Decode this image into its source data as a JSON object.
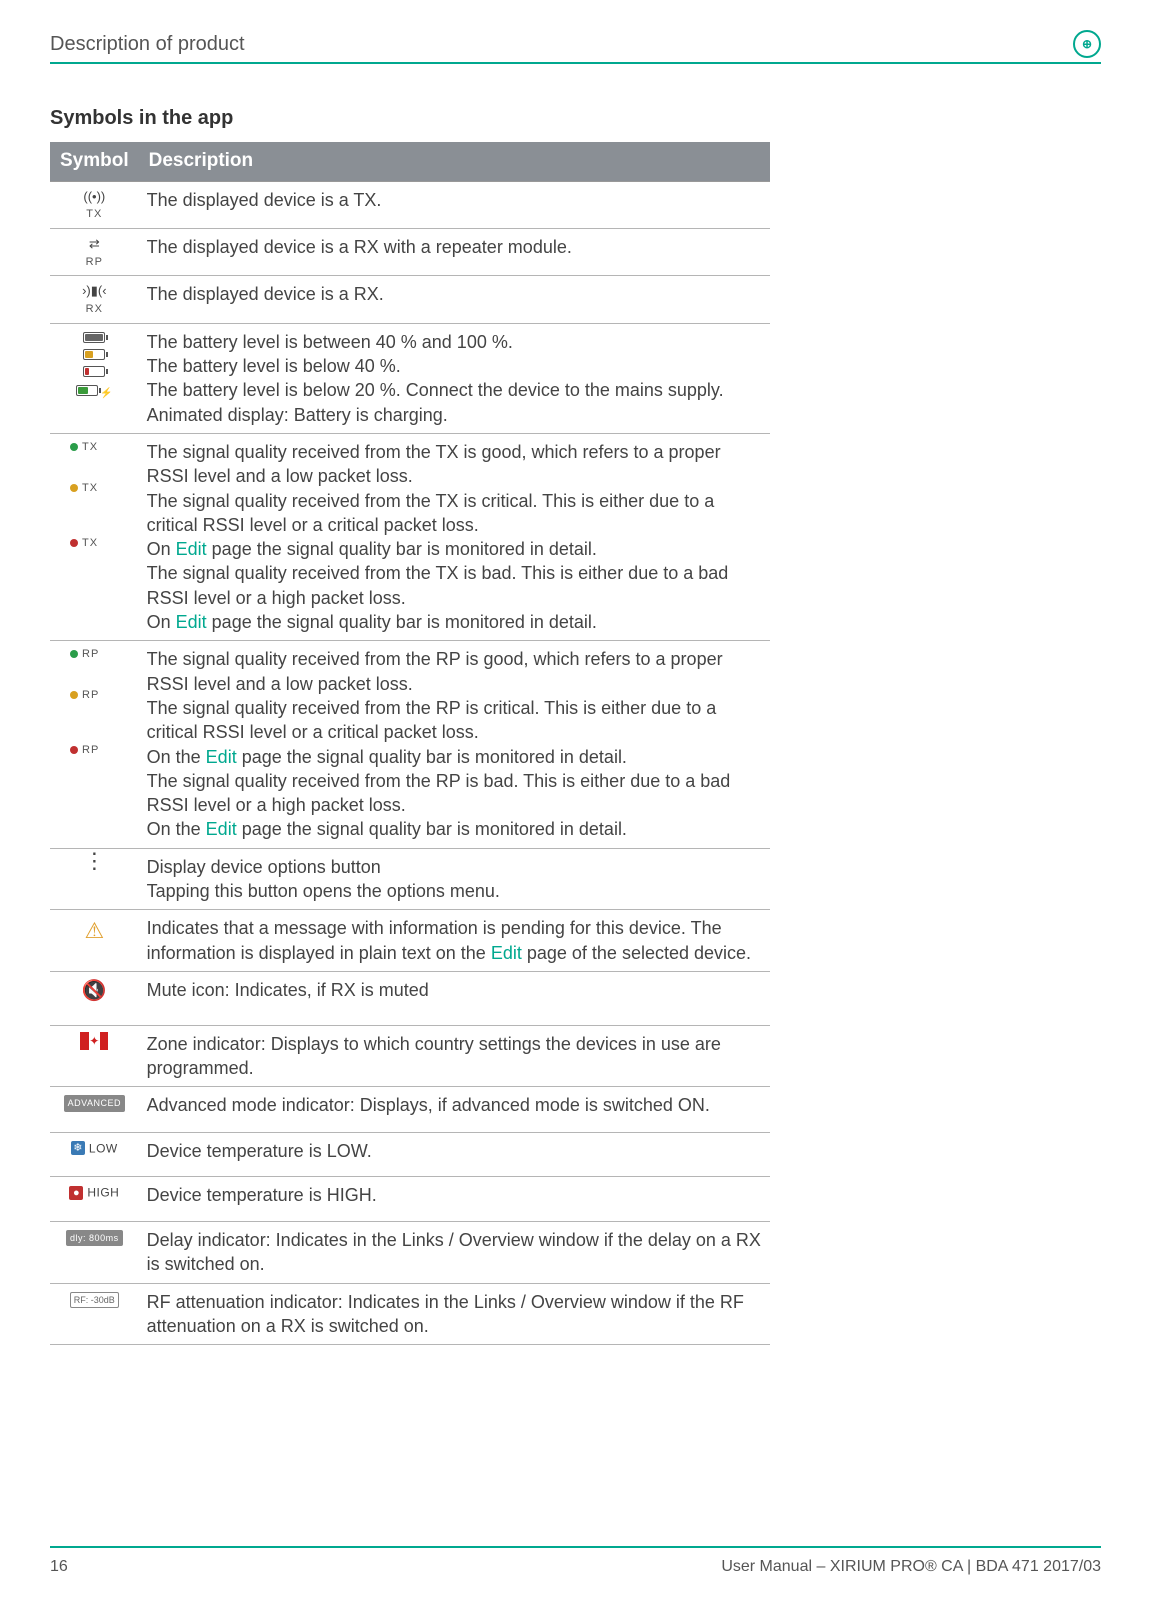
{
  "header": {
    "title": "Description of product",
    "logo_alt": "brand logo"
  },
  "section_title": "Symbols in the app",
  "table": {
    "head": {
      "symbol": "Symbol",
      "description": "Description"
    },
    "rows": {
      "tx": {
        "label": "TX",
        "desc": "The displayed device is a TX."
      },
      "rp": {
        "label": "RP",
        "desc": "The displayed device is a RX with a repeater module."
      },
      "rx": {
        "label": "RX",
        "desc": "The displayed device is a RX."
      },
      "battery": {
        "line1": "The battery level is between 40 % and 100 %.",
        "line2": "The battery level is below 40 %.",
        "line3": "The battery level is below 20 %. Connect the device to the mains supply.",
        "line4": "Animated display: Battery is charging."
      },
      "sig_tx": {
        "label": "TX",
        "good": "The signal quality received from the TX is good, which refers to a proper RSSI level and a low packet loss.",
        "crit1": "The signal quality received from the TX is critical. This is either due to a critical RSSI level or a critical packet loss.",
        "crit2_pre": "On ",
        "crit2_link": "Edit",
        "crit2_post": " page the signal quality bar is monitored in detail.",
        "bad1": "The signal quality received from the TX is bad. This is either due to a bad RSSI level or a high packet loss.",
        "bad2_pre": "On ",
        "bad2_link": "Edit",
        "bad2_post": " page the signal quality bar is monitored in detail."
      },
      "sig_rp": {
        "label": "RP",
        "good": "The signal quality received from the RP is good, which refers to a proper RSSI level and a low packet loss.",
        "crit1": "The signal quality received from the RP is critical. This is either due to a critical RSSI level or a critical packet loss.",
        "crit2_pre": "On the ",
        "crit2_link": "Edit",
        "crit2_post": " page the signal quality bar is monitored in detail.",
        "bad1": "The signal quality received from the RP is bad. This is either due to a bad RSSI level or a high packet loss.",
        "bad2_pre": "On the ",
        "bad2_link": "Edit",
        "bad2_post": " page the signal quality bar is monitored in detail."
      },
      "options": {
        "line1": "Display device options button",
        "line2": "Tapping this button opens the options menu."
      },
      "warning": {
        "pre": "Indicates that a message with information is pending for this device. The information is displayed in plain text on the ",
        "link": "Edit",
        "post": " page of the selected device."
      },
      "mute": "Mute icon: Indicates, if RX is muted",
      "zone": "Zone indicator: Displays to which country settings the devices in use are programmed.",
      "advanced": {
        "badge": "ADVANCED",
        "desc": "Advanced mode indicator: Displays, if advanced mode is switched ON."
      },
      "temp_low": {
        "label": "LOW",
        "desc": "Device temperature is LOW."
      },
      "temp_high": {
        "label": "HIGH",
        "desc": "Device temperature is HIGH."
      },
      "delay": {
        "badge": "dly: 800ms",
        "desc": "Delay indicator: Indicates in the Links / Overview window if the delay on a RX is switched on."
      },
      "rf": {
        "badge": "RF: -30dB",
        "desc": "RF attenuation indicator: Indicates in the Links / Overview window if the RF attenuation on a RX is switched on."
      }
    }
  },
  "footer": {
    "page": "16",
    "doc": "User Manual – XIRIUM PRO® CA | BDA 471 2017/03"
  }
}
